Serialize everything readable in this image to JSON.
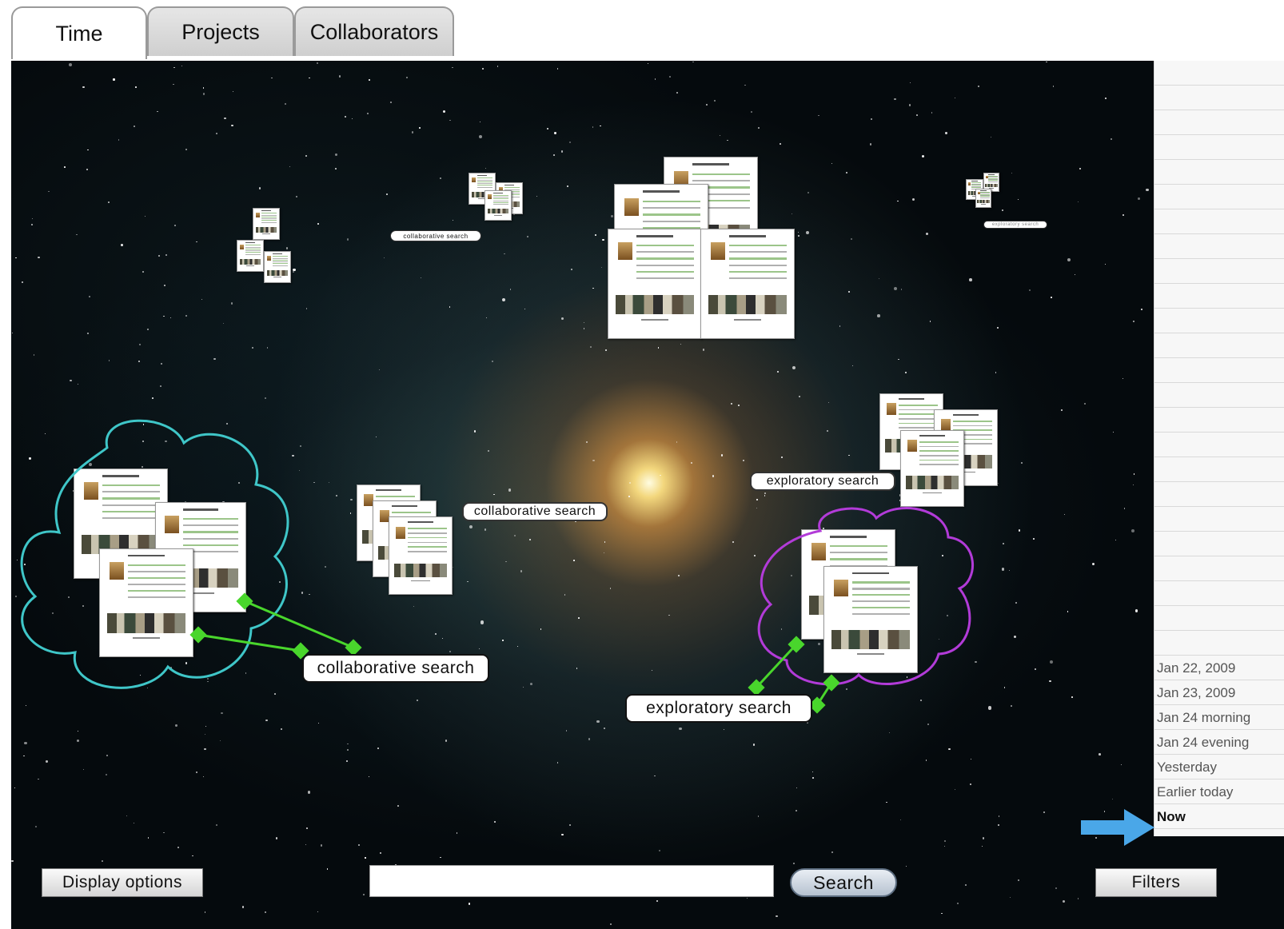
{
  "tabs": [
    {
      "label": "Time",
      "active": true
    },
    {
      "label": "Projects",
      "active": false
    },
    {
      "label": "Collaborators",
      "active": false
    }
  ],
  "space": {
    "small_labels": [
      "collaborative search",
      "exploratory search"
    ],
    "labels": {
      "collab_mid": "collaborative search",
      "explore_mid": "exploratory search",
      "collab_group": "collaborative search",
      "explore_group": "exploratory search"
    },
    "group_colors": {
      "collaborative": "#3fc6c8",
      "exploratory": "#b23bd8",
      "connector": "#49d62c"
    }
  },
  "timeline": {
    "entries": [
      "Jan 22, 2009",
      "Jan 23, 2009",
      "Jan 24 morning",
      "Jan 24 evening",
      "Yesterday",
      "Earlier today",
      "Now"
    ],
    "current": "Now",
    "arrow_color": "#4aa7e8"
  },
  "toolbar": {
    "display_options_label": "Display options",
    "search_value": "",
    "search_placeholder": "",
    "search_label": "Search",
    "filters_label": "Filters"
  }
}
